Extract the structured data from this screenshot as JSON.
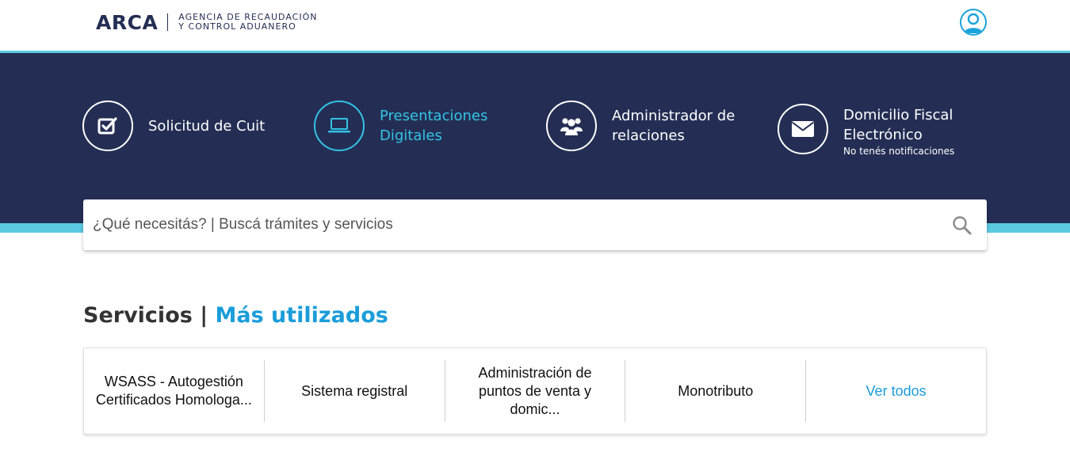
{
  "header": {
    "logo_word": "ARCA",
    "logo_line1": "AGENCIA DE RECAUDACIÓN",
    "logo_line2": "Y CONTROL ADUANERO",
    "user_icon": "user-circle-icon"
  },
  "quick_links": [
    {
      "line1": "Solicitud de Cuit",
      "line2": "",
      "sub": "",
      "icon": "checkbox-icon"
    },
    {
      "line1": "Presentaciones",
      "line2": "Digitales",
      "sub": "",
      "icon": "laptop-icon"
    },
    {
      "line1": "Administrador de",
      "line2": "relaciones",
      "sub": "",
      "icon": "users-icon"
    },
    {
      "line1": "Domicilio Fiscal",
      "line2": "Electrónico",
      "sub": "No tenés notificaciones",
      "icon": "envelope-icon"
    }
  ],
  "search": {
    "placeholder": "¿Qué necesitás? | Buscá trámites y servicios",
    "icon": "search-icon"
  },
  "services": {
    "title": "Servicios |",
    "subtitle": "Más utilizados",
    "items": [
      "WSASS - Autogestión Certificados Homologa...",
      "Sistema registral",
      "Administración de puntos de venta y domic...",
      "Monotributo"
    ],
    "view_all": "Ver todos"
  },
  "colors": {
    "navy": "#242e54",
    "cyan": "#5bc9e0",
    "accent_blue": "#1a9dd9",
    "active_cyan": "#33c3e6"
  }
}
